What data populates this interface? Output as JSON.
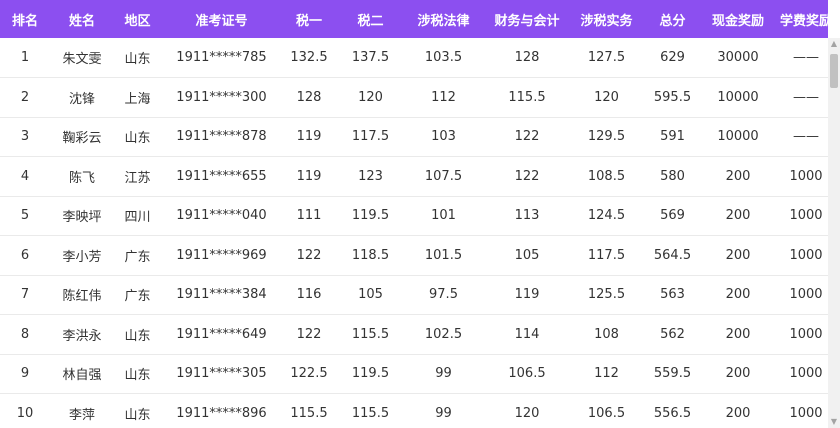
{
  "table": {
    "headers": [
      "排名",
      "姓名",
      "地区",
      "准考证号",
      "税一",
      "税二",
      "涉税法律",
      "财务与会计",
      "涉税实务",
      "总分",
      "现金奖励",
      "学费奖励"
    ],
    "rows": [
      [
        "1",
        "朱文雯",
        "山东",
        "1911*****785",
        "132.5",
        "137.5",
        "103.5",
        "128",
        "127.5",
        "629",
        "30000",
        "——"
      ],
      [
        "2",
        "沈锋",
        "上海",
        "1911*****300",
        "128",
        "120",
        "112",
        "115.5",
        "120",
        "595.5",
        "10000",
        "——"
      ],
      [
        "3",
        "鞠彩云",
        "山东",
        "1911*****878",
        "119",
        "117.5",
        "103",
        "122",
        "129.5",
        "591",
        "10000",
        "——"
      ],
      [
        "4",
        "陈飞",
        "江苏",
        "1911*****655",
        "119",
        "123",
        "107.5",
        "122",
        "108.5",
        "580",
        "200",
        "1000"
      ],
      [
        "5",
        "李映坪",
        "四川",
        "1911*****040",
        "111",
        "119.5",
        "101",
        "113",
        "124.5",
        "569",
        "200",
        "1000"
      ],
      [
        "6",
        "李小芳",
        "广东",
        "1911*****969",
        "122",
        "118.5",
        "101.5",
        "105",
        "117.5",
        "564.5",
        "200",
        "1000"
      ],
      [
        "7",
        "陈红伟",
        "广东",
        "1911*****384",
        "116",
        "105",
        "97.5",
        "119",
        "125.5",
        "563",
        "200",
        "1000"
      ],
      [
        "8",
        "李洪永",
        "山东",
        "1911*****649",
        "122",
        "115.5",
        "102.5",
        "114",
        "108",
        "562",
        "200",
        "1000"
      ],
      [
        "9",
        "林自强",
        "山东",
        "1911*****305",
        "122.5",
        "119.5",
        "99",
        "106.5",
        "112",
        "559.5",
        "200",
        "1000"
      ],
      [
        "10",
        "李萍",
        "山东",
        "1911*****896",
        "115.5",
        "115.5",
        "99",
        "120",
        "106.5",
        "556.5",
        "200",
        "1000"
      ]
    ]
  },
  "scrollbar": {
    "up_icon": "▲",
    "down_icon": "▼"
  },
  "colors": {
    "header_bg": "#8c4ff0",
    "header_text": "#ffffff",
    "row_border": "#eaeaea"
  }
}
